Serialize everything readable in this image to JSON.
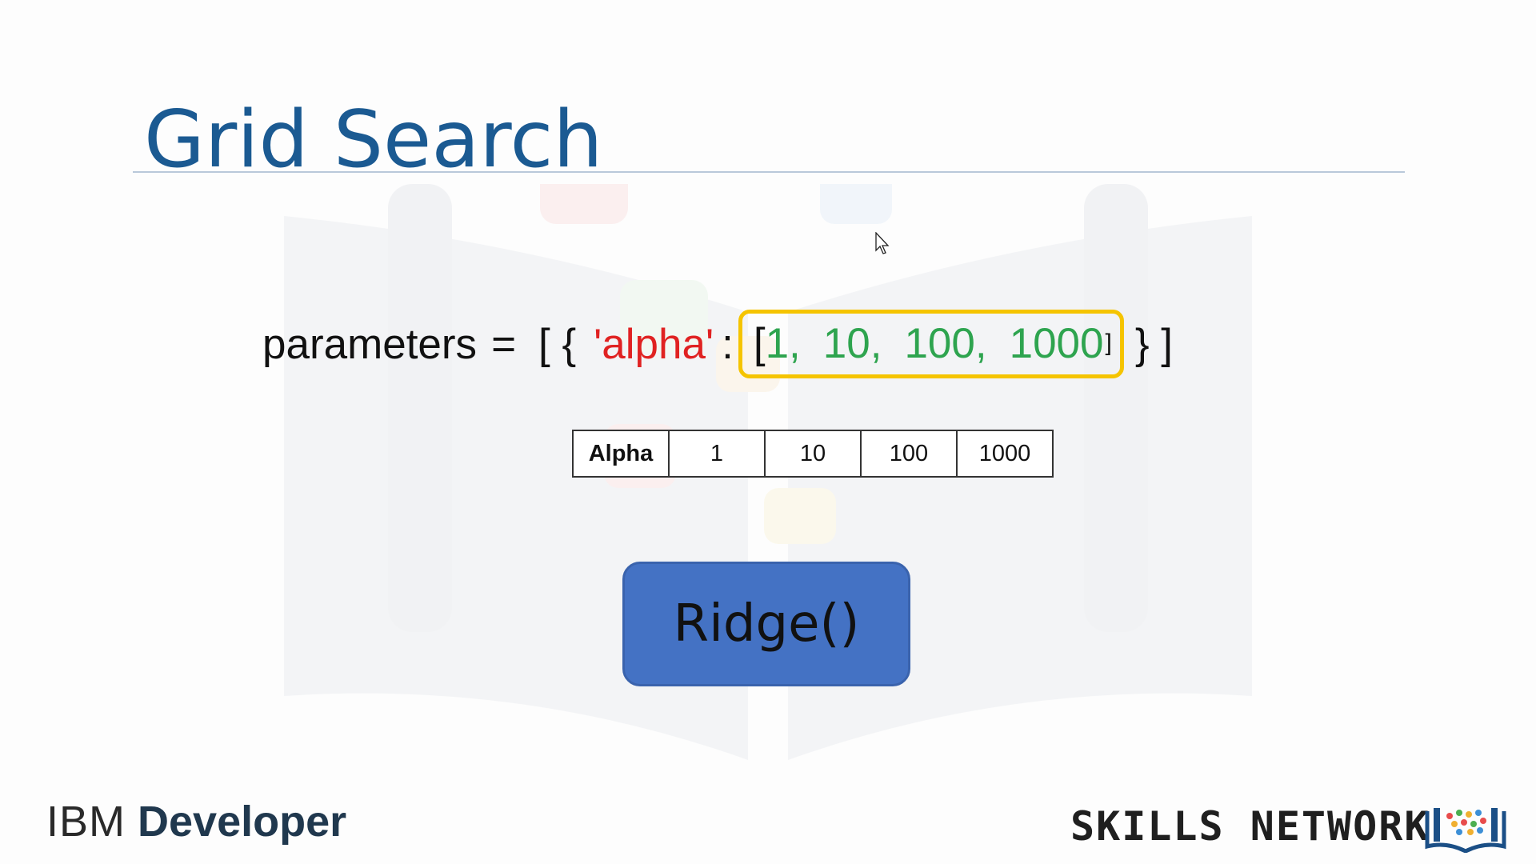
{
  "slide": {
    "title": "Grid Search",
    "colors": {
      "title": "#1b5a92",
      "key_string": "#e02222",
      "numbers": "#2ea44f",
      "highlight_border": "#f5c400",
      "button_fill": "#4472c4"
    }
  },
  "code_line": {
    "variable": "parameters",
    "equals": "=",
    "open_brackets": "[ {",
    "key": "'alpha'",
    "colon": ":",
    "list_open": "[",
    "values": [
      "1,",
      "10,",
      "100,",
      "1000"
    ],
    "list_close": "]",
    "close_brackets": "} ]"
  },
  "alpha_table": {
    "header": "Alpha",
    "values": [
      "1",
      "10",
      "100",
      "1000"
    ]
  },
  "model_button": {
    "label": "Ridge()"
  },
  "footer": {
    "ibm_part": "IBM",
    "developer_part": "Developer",
    "skills_network": "SKILLS NETWORK"
  },
  "icons": {
    "cursor": "mouse-pointer-icon",
    "watermark": "open-book-icon",
    "skills_logo": "book-dots-icon"
  }
}
